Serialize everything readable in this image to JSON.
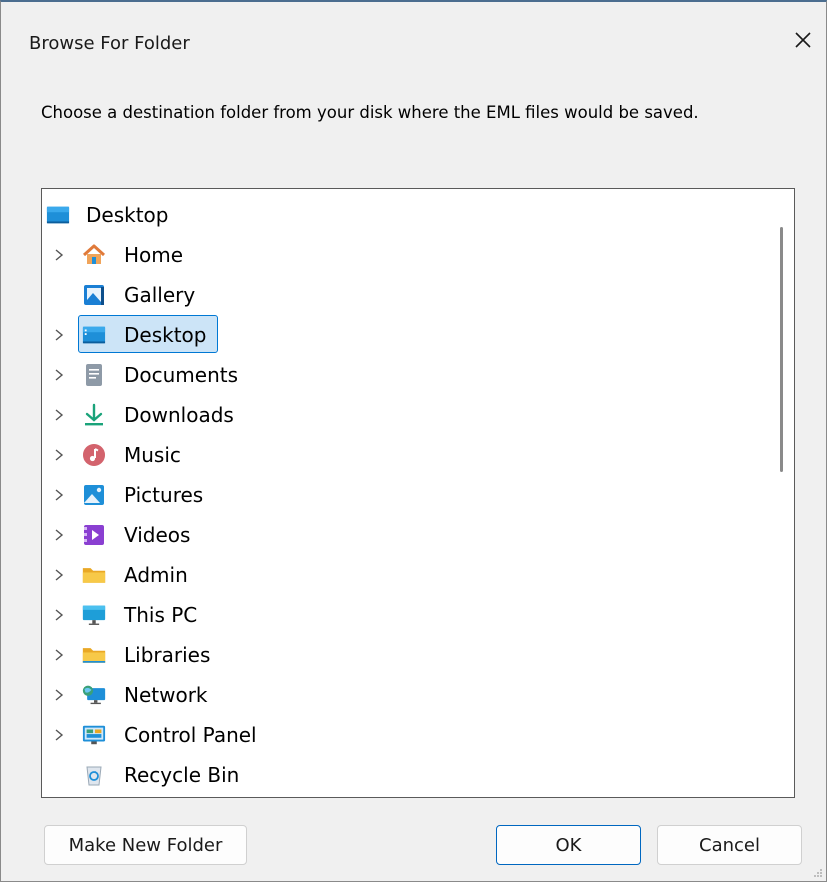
{
  "window": {
    "title": "Browse For Folder",
    "close_label": "×"
  },
  "instruction": "Choose a destination folder from your disk where the EML files would be saved.",
  "tree": {
    "root": {
      "label": "Desktop",
      "icon": "desktop-folder-icon"
    },
    "items": [
      {
        "label": "Home",
        "icon": "home-icon",
        "expandable": true
      },
      {
        "label": "Gallery",
        "icon": "gallery-icon",
        "expandable": false
      },
      {
        "label": "Desktop",
        "icon": "desktop-folder-icon",
        "expandable": true,
        "selected": true
      },
      {
        "label": "Documents",
        "icon": "documents-icon",
        "expandable": true
      },
      {
        "label": "Downloads",
        "icon": "downloads-icon",
        "expandable": true
      },
      {
        "label": "Music",
        "icon": "music-icon",
        "expandable": true
      },
      {
        "label": "Pictures",
        "icon": "pictures-icon",
        "expandable": true
      },
      {
        "label": "Videos",
        "icon": "videos-icon",
        "expandable": true
      },
      {
        "label": "Admin",
        "icon": "folder-icon",
        "expandable": true
      },
      {
        "label": "This PC",
        "icon": "this-pc-icon",
        "expandable": true
      },
      {
        "label": "Libraries",
        "icon": "libraries-icon",
        "expandable": true
      },
      {
        "label": "Network",
        "icon": "network-icon",
        "expandable": true
      },
      {
        "label": "Control Panel",
        "icon": "control-panel-icon",
        "expandable": true
      },
      {
        "label": "Recycle Bin",
        "icon": "recycle-bin-icon",
        "expandable": false
      }
    ]
  },
  "buttons": {
    "make_new_folder": "Make New Folder",
    "ok": "OK",
    "cancel": "Cancel"
  },
  "colors": {
    "selection_bg": "#cce4f7",
    "selection_border": "#0078d4",
    "accent": "#0067c0",
    "folder_yellow": "#f7c948"
  }
}
